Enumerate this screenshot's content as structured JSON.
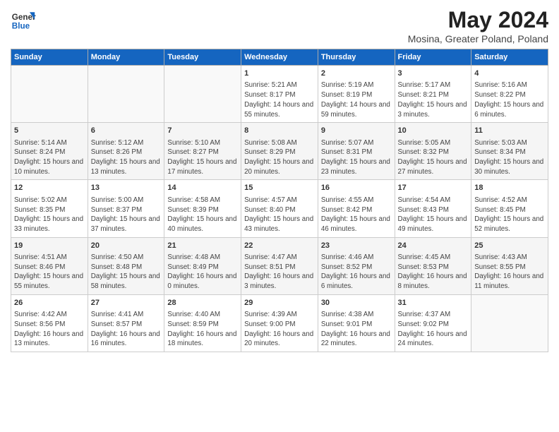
{
  "header": {
    "logo_general": "General",
    "logo_blue": "Blue",
    "main_title": "May 2024",
    "subtitle": "Mosina, Greater Poland, Poland"
  },
  "days_of_week": [
    "Sunday",
    "Monday",
    "Tuesday",
    "Wednesday",
    "Thursday",
    "Friday",
    "Saturday"
  ],
  "weeks": [
    [
      {
        "day": "",
        "content": ""
      },
      {
        "day": "",
        "content": ""
      },
      {
        "day": "",
        "content": ""
      },
      {
        "day": "1",
        "content": "Sunrise: 5:21 AM\nSunset: 8:17 PM\nDaylight: 14 hours and 55 minutes."
      },
      {
        "day": "2",
        "content": "Sunrise: 5:19 AM\nSunset: 8:19 PM\nDaylight: 14 hours and 59 minutes."
      },
      {
        "day": "3",
        "content": "Sunrise: 5:17 AM\nSunset: 8:21 PM\nDaylight: 15 hours and 3 minutes."
      },
      {
        "day": "4",
        "content": "Sunrise: 5:16 AM\nSunset: 8:22 PM\nDaylight: 15 hours and 6 minutes."
      }
    ],
    [
      {
        "day": "5",
        "content": "Sunrise: 5:14 AM\nSunset: 8:24 PM\nDaylight: 15 hours and 10 minutes."
      },
      {
        "day": "6",
        "content": "Sunrise: 5:12 AM\nSunset: 8:26 PM\nDaylight: 15 hours and 13 minutes."
      },
      {
        "day": "7",
        "content": "Sunrise: 5:10 AM\nSunset: 8:27 PM\nDaylight: 15 hours and 17 minutes."
      },
      {
        "day": "8",
        "content": "Sunrise: 5:08 AM\nSunset: 8:29 PM\nDaylight: 15 hours and 20 minutes."
      },
      {
        "day": "9",
        "content": "Sunrise: 5:07 AM\nSunset: 8:31 PM\nDaylight: 15 hours and 23 minutes."
      },
      {
        "day": "10",
        "content": "Sunrise: 5:05 AM\nSunset: 8:32 PM\nDaylight: 15 hours and 27 minutes."
      },
      {
        "day": "11",
        "content": "Sunrise: 5:03 AM\nSunset: 8:34 PM\nDaylight: 15 hours and 30 minutes."
      }
    ],
    [
      {
        "day": "12",
        "content": "Sunrise: 5:02 AM\nSunset: 8:35 PM\nDaylight: 15 hours and 33 minutes."
      },
      {
        "day": "13",
        "content": "Sunrise: 5:00 AM\nSunset: 8:37 PM\nDaylight: 15 hours and 37 minutes."
      },
      {
        "day": "14",
        "content": "Sunrise: 4:58 AM\nSunset: 8:39 PM\nDaylight: 15 hours and 40 minutes."
      },
      {
        "day": "15",
        "content": "Sunrise: 4:57 AM\nSunset: 8:40 PM\nDaylight: 15 hours and 43 minutes."
      },
      {
        "day": "16",
        "content": "Sunrise: 4:55 AM\nSunset: 8:42 PM\nDaylight: 15 hours and 46 minutes."
      },
      {
        "day": "17",
        "content": "Sunrise: 4:54 AM\nSunset: 8:43 PM\nDaylight: 15 hours and 49 minutes."
      },
      {
        "day": "18",
        "content": "Sunrise: 4:52 AM\nSunset: 8:45 PM\nDaylight: 15 hours and 52 minutes."
      }
    ],
    [
      {
        "day": "19",
        "content": "Sunrise: 4:51 AM\nSunset: 8:46 PM\nDaylight: 15 hours and 55 minutes."
      },
      {
        "day": "20",
        "content": "Sunrise: 4:50 AM\nSunset: 8:48 PM\nDaylight: 15 hours and 58 minutes."
      },
      {
        "day": "21",
        "content": "Sunrise: 4:48 AM\nSunset: 8:49 PM\nDaylight: 16 hours and 0 minutes."
      },
      {
        "day": "22",
        "content": "Sunrise: 4:47 AM\nSunset: 8:51 PM\nDaylight: 16 hours and 3 minutes."
      },
      {
        "day": "23",
        "content": "Sunrise: 4:46 AM\nSunset: 8:52 PM\nDaylight: 16 hours and 6 minutes."
      },
      {
        "day": "24",
        "content": "Sunrise: 4:45 AM\nSunset: 8:53 PM\nDaylight: 16 hours and 8 minutes."
      },
      {
        "day": "25",
        "content": "Sunrise: 4:43 AM\nSunset: 8:55 PM\nDaylight: 16 hours and 11 minutes."
      }
    ],
    [
      {
        "day": "26",
        "content": "Sunrise: 4:42 AM\nSunset: 8:56 PM\nDaylight: 16 hours and 13 minutes."
      },
      {
        "day": "27",
        "content": "Sunrise: 4:41 AM\nSunset: 8:57 PM\nDaylight: 16 hours and 16 minutes."
      },
      {
        "day": "28",
        "content": "Sunrise: 4:40 AM\nSunset: 8:59 PM\nDaylight: 16 hours and 18 minutes."
      },
      {
        "day": "29",
        "content": "Sunrise: 4:39 AM\nSunset: 9:00 PM\nDaylight: 16 hours and 20 minutes."
      },
      {
        "day": "30",
        "content": "Sunrise: 4:38 AM\nSunset: 9:01 PM\nDaylight: 16 hours and 22 minutes."
      },
      {
        "day": "31",
        "content": "Sunrise: 4:37 AM\nSunset: 9:02 PM\nDaylight: 16 hours and 24 minutes."
      },
      {
        "day": "",
        "content": ""
      }
    ]
  ]
}
